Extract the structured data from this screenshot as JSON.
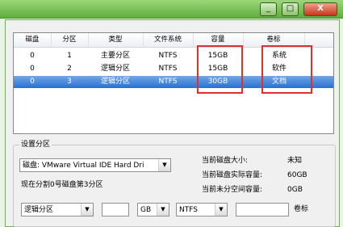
{
  "window": {
    "buttons": {
      "minimize": "_",
      "maximize": "□",
      "close": "X"
    }
  },
  "partition_table": {
    "columns": [
      "磁盘",
      "分区",
      "类型",
      "文件系统",
      "容量",
      "卷标"
    ],
    "rows": [
      {
        "disk": "0",
        "partition": "1",
        "type": "主要分区",
        "fs": "NTFS",
        "capacity": "15GB",
        "label": "系统",
        "selected": false
      },
      {
        "disk": "0",
        "partition": "2",
        "type": "逻辑分区",
        "fs": "NTFS",
        "capacity": "15GB",
        "label": "软件",
        "selected": false
      },
      {
        "disk": "0",
        "partition": "3",
        "type": "逻辑分区",
        "fs": "NTFS",
        "capacity": "30GB",
        "label": "文档",
        "selected": true
      }
    ]
  },
  "settings": {
    "group_title": "设置分区",
    "disk_select": "磁盘: VMware Virtual IDE Hard Dri",
    "current_info": "现在分割0号磁盘第3分区",
    "stats": [
      {
        "label": "当前磁盘大小:",
        "value": "未知"
      },
      {
        "label": "当前磁盘实际容量:",
        "value": "60GB"
      },
      {
        "label": "当前未分空间容量:",
        "value": "0GB"
      }
    ],
    "type_select": "逻辑分区",
    "size_value": "",
    "unit_select": "GB",
    "fs_select": "NTFS",
    "label_field_value": "",
    "label_caption": "卷标"
  },
  "colors": {
    "highlight": "#e0302a",
    "selection": "#2e6fcf"
  }
}
